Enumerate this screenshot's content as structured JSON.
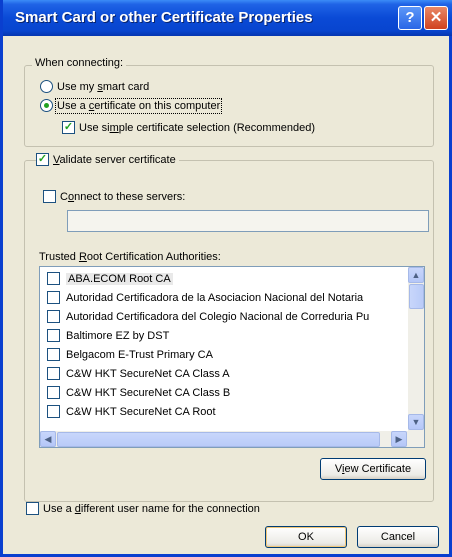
{
  "window": {
    "title": "Smart Card or other Certificate Properties",
    "help_button": "?",
    "close_button": "✕"
  },
  "connecting": {
    "legend": "When connecting:",
    "option_smart_card": {
      "pre": "Use my ",
      "key": "s",
      "post": "mart card",
      "selected": false
    },
    "option_certificate": {
      "pre": "Use a ",
      "key": "c",
      "post": "ertificate on this computer",
      "selected": true
    },
    "simple_selection": {
      "pre": "Use si",
      "key": "m",
      "post": "ple certificate selection (Recommended)",
      "checked": true
    }
  },
  "validate": {
    "label": {
      "pre": "",
      "key": "V",
      "post": "alidate server certificate",
      "checked": true
    },
    "connect_to_servers": {
      "pre": "C",
      "key": "o",
      "post": "nnect to these servers:",
      "checked": false
    },
    "servers_value": "",
    "trusted_label": {
      "pre": "Trusted ",
      "key": "R",
      "post": "oot Certification Authorities:"
    },
    "authorities": [
      {
        "name": "ABA.ECOM Root CA",
        "checked": false
      },
      {
        "name": "Autoridad Certificadora de la Asociacion Nacional del Notaria",
        "checked": false
      },
      {
        "name": "Autoridad Certificadora del Colegio Nacional de Correduria Pu",
        "checked": false
      },
      {
        "name": "Baltimore EZ by DST",
        "checked": false
      },
      {
        "name": "Belgacom E-Trust Primary CA",
        "checked": false
      },
      {
        "name": "C&W HKT SecureNet CA Class A",
        "checked": false
      },
      {
        "name": "C&W HKT SecureNet CA Class B",
        "checked": false
      },
      {
        "name": "C&W HKT SecureNet CA Root",
        "checked": false
      }
    ],
    "view_certificate": {
      "pre": "V",
      "key": "i",
      "post": "ew Certificate"
    }
  },
  "different_user": {
    "pre": "Use a ",
    "key": "d",
    "post": "ifferent user name for the connection",
    "checked": false
  },
  "buttons": {
    "ok": "OK",
    "cancel": "Cancel"
  },
  "colors": {
    "title_blue": "#0a4ad6",
    "dialog_bg": "#ece9d8",
    "check_green": "#21a121"
  }
}
